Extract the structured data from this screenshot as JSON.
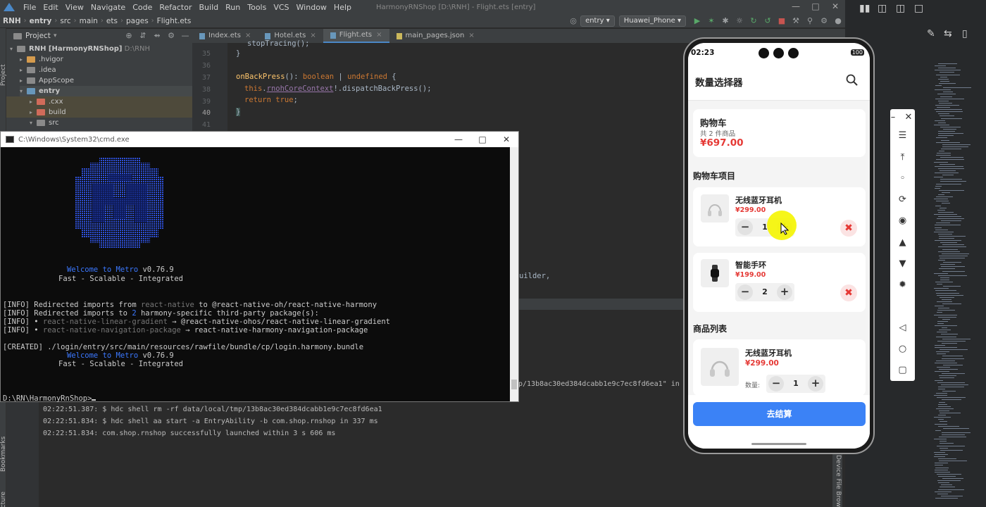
{
  "ide": {
    "menu": [
      "File",
      "Edit",
      "View",
      "Navigate",
      "Code",
      "Refactor",
      "Build",
      "Run",
      "Tools",
      "VCS",
      "Window",
      "Help"
    ],
    "window_title": "HarmonyRNShop [D:\\RNH] - Flight.ets [entry]",
    "breadcrumbs": [
      "RNH",
      "entry",
      "src",
      "main",
      "ets",
      "pages",
      "Flight.ets"
    ],
    "run_config": "entry",
    "device": "Huawei_Phone",
    "project_label": "Project",
    "tree": [
      {
        "label": "RNH [HarmonyRNShop]",
        "hint": "D:\\RNH"
      },
      {
        "label": ".hvigor"
      },
      {
        "label": ".idea"
      },
      {
        "label": "AppScope"
      },
      {
        "label": "entry"
      },
      {
        "label": ".cxx"
      },
      {
        "label": "build"
      },
      {
        "label": "src"
      }
    ],
    "tabs": [
      "Index.ets",
      "Hotel.ets",
      "Flight.ets",
      "main_pages.json"
    ],
    "line_numbers": [
      "35",
      "36",
      "37",
      "38",
      "39",
      "40",
      "41"
    ],
    "code": {
      "l35_a": "stopTracing();",
      "l35_b": "}",
      "l37_fn": "onBackPress",
      "l37_rest": "(): ",
      "l37_type": "boolean",
      "l37_pipe": " | ",
      "l37_undef": "undefined",
      "l37_brace": " {",
      "l38_this": "this",
      "l38_dot": ".",
      "l38_prop": "rnohCoreContext",
      "l38_rest": "!.dispatchBackPress();",
      "l39_kw": "return",
      "l39_val": " true",
      "l39_end": ";",
      "l40": "}",
      "builder": "uilder,"
    },
    "side_labels": {
      "project": "Project",
      "bookmarks": "Bookmarks",
      "structure": "Structure",
      "device_file_browser": "Device File Browser"
    },
    "run_log": [
      "02:22:51.387: $ hdc shell rm -rf data/local/tmp/13b8ac30ed384dcabb1e9c7ec8fd6ea1",
      "02:22:51.834: $ hdc shell aa start -a EntryAbility -b com.shop.rnshop in 337 ms",
      "02:22:51.834: com.shop.rnshop successfully launched within 3 s 606 ms"
    ],
    "run_fragment": "p/13b8ac30ed384dcabb1e9c7ec8fd6ea1\" in"
  },
  "cmd": {
    "title": "C:\\Windows\\System32\\cmd.exe",
    "welcome_prefix": "Welcome to ",
    "welcome_metro": "Metro",
    "version": " v0.76.9",
    "tagline": "Fast - Scalable - Integrated",
    "info1_prefix": "[INFO] Redirected imports from ",
    "info1_rn": "react-native",
    "info1_suffix": " to @react-native-oh/react-native-harmony",
    "info2_prefix": "[INFO] Redirected imports to ",
    "info2_num": "2",
    "info2_suffix": " harmony-specific third-party package(s):",
    "info3_prefix": "[INFO] • ",
    "info3_pkg": "react-native-linear-gradient",
    "info3_suffix": " → @react-native-ohos/react-native-linear-gradient",
    "info4_prefix": "[INFO] • ",
    "info4_pkg": "react-native-navigation-package",
    "info4_suffix": " → react-native-harmony-navigation-package",
    "created": "[CREATED] ./login/entry/src/main/resources/rawfile/bundle/cp/login.harmony.bundle",
    "prompt": "D:\\RN\\HarmonyRnShop>"
  },
  "app": {
    "status_time": "02:23",
    "battery": "100",
    "title": "数量选择器",
    "cart_title": "购物车",
    "cart_count": "共 2 件商品",
    "cart_total": "¥697.00",
    "cart_items_label": "购物车项目",
    "cart_items": [
      {
        "name": "无线蓝牙耳机",
        "price": "¥299.00",
        "qty": "1",
        "icon": "headphones-icon"
      },
      {
        "name": "智能手环",
        "price": "¥199.00",
        "qty": "2",
        "icon": "watch-icon"
      }
    ],
    "product_list_label": "商品列表",
    "products": [
      {
        "name": "无线蓝牙耳机",
        "price": "¥299.00",
        "qty_label": "数量:",
        "qty": "1"
      }
    ],
    "checkout": "去结算"
  },
  "colors": {
    "accent": "#3b82f6",
    "price": "#e53935",
    "metro_blue": "#3b78ff"
  }
}
